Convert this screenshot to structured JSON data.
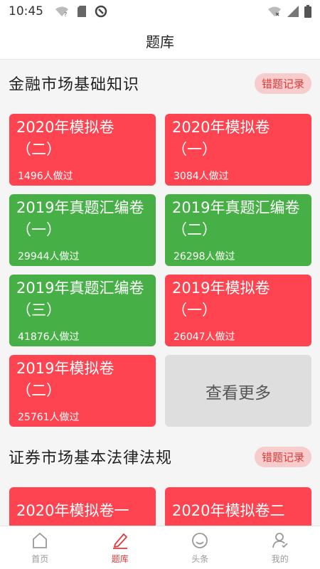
{
  "status_bar": {
    "time": "10:45"
  },
  "header": {
    "title": "题库"
  },
  "sections": [
    {
      "title": "金融市场基础知识",
      "record_label": "错题记录",
      "cards": [
        {
          "title": "2020年模拟卷",
          "sub": "（二）",
          "count": "1496人做过",
          "color": "red"
        },
        {
          "title": "2020年模拟卷",
          "sub": "（一）",
          "count": "3084人做过",
          "color": "red"
        },
        {
          "title": "2019年真题汇编卷",
          "sub": "（一）",
          "count": "29944人做过",
          "color": "green"
        },
        {
          "title": "2019年真题汇编卷",
          "sub": "（二）",
          "count": "26298人做过",
          "color": "green"
        },
        {
          "title": "2019年真题汇编卷",
          "sub": "（三）",
          "count": "41876人做过",
          "color": "green"
        },
        {
          "title": "2019年模拟卷",
          "sub": "（一）",
          "count": "26047人做过",
          "color": "red"
        },
        {
          "title": "2019年模拟卷",
          "sub": "（二）",
          "count": "25761人做过",
          "color": "red"
        }
      ],
      "more_label": "查看更多"
    },
    {
      "title": "证券市场基本法律法规",
      "record_label": "错题记录",
      "cards": [
        {
          "title": "2020年模拟卷一",
          "color": "red"
        },
        {
          "title": "2020年模拟卷二",
          "color": "red"
        }
      ]
    }
  ],
  "bottom_nav": [
    {
      "label": "首页",
      "icon": "home-icon"
    },
    {
      "label": "题库",
      "icon": "pencil-icon"
    },
    {
      "label": "头条",
      "icon": "smile-icon"
    },
    {
      "label": "我的",
      "icon": "user-icon"
    }
  ],
  "colors": {
    "red": "#ff4451",
    "green": "#46b046",
    "grey": "#dedede",
    "accent": "#e03a3a"
  }
}
